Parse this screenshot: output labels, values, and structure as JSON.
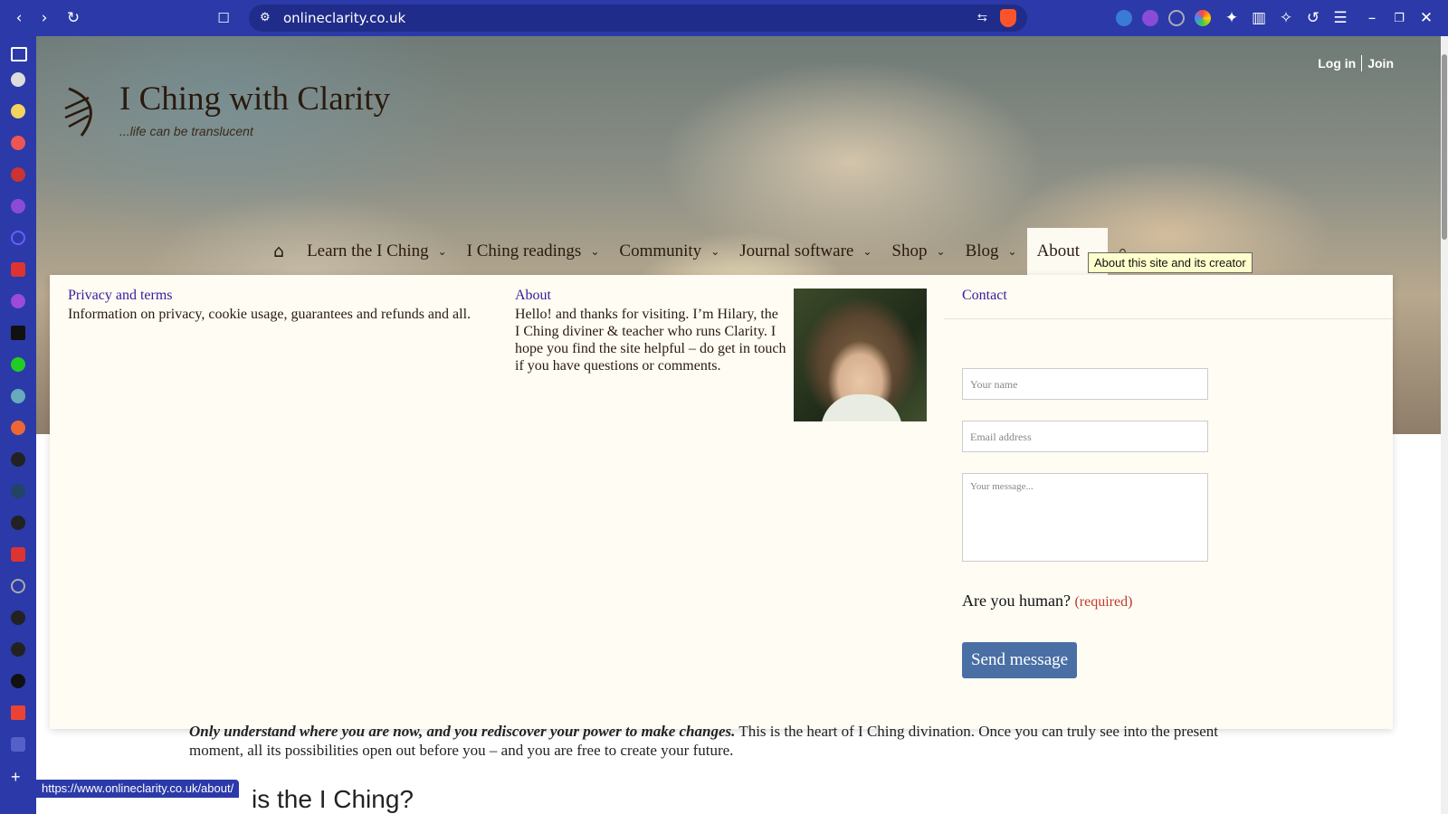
{
  "browser": {
    "url": "onlineclarity.co.uk",
    "status_url": "https://www.onlineclarity.co.uk/about/"
  },
  "site": {
    "title": "I Ching with Clarity",
    "tagline": "...life can be translucent",
    "login": "Log in",
    "join": "Join"
  },
  "nav": {
    "items": [
      {
        "label": "Learn the I Ching"
      },
      {
        "label": "I Ching readings"
      },
      {
        "label": "Community"
      },
      {
        "label": "Journal software"
      },
      {
        "label": "Shop"
      },
      {
        "label": "Blog"
      },
      {
        "label": "About"
      }
    ],
    "tooltip": "About this site and its creator"
  },
  "mega": {
    "privacy": {
      "title": "Privacy and terms",
      "text": "Information on privacy, cookie usage, guarantees and refunds and all."
    },
    "about": {
      "title": "About",
      "text": "Hello! and thanks for visiting. I’m Hilary, the I Ching diviner & teacher who runs Clarity. I hope you find the site helpful – do get in touch if you have questions or comments."
    },
    "contact": {
      "title": "Contact",
      "name_placeholder": "Your name",
      "email_placeholder": "Email address",
      "message_placeholder": "Your message...",
      "human_label": "Are you human?",
      "required": "(required)",
      "send": "Send message"
    }
  },
  "content": {
    "lead_em": "Only understand where you are now, and you rediscover your power to make changes.",
    "lead_rest": " This is the heart of I Ching divination. Once you can truly see into the present moment, all its possibilities open out before you – and you are free to create your future.",
    "heading_fragment": "is the I Ching?"
  },
  "colors": {
    "browser_chrome": "#2b3aa8",
    "link": "#3a1a9a",
    "send_button": "#4a6fa5",
    "required": "#c0392b"
  }
}
